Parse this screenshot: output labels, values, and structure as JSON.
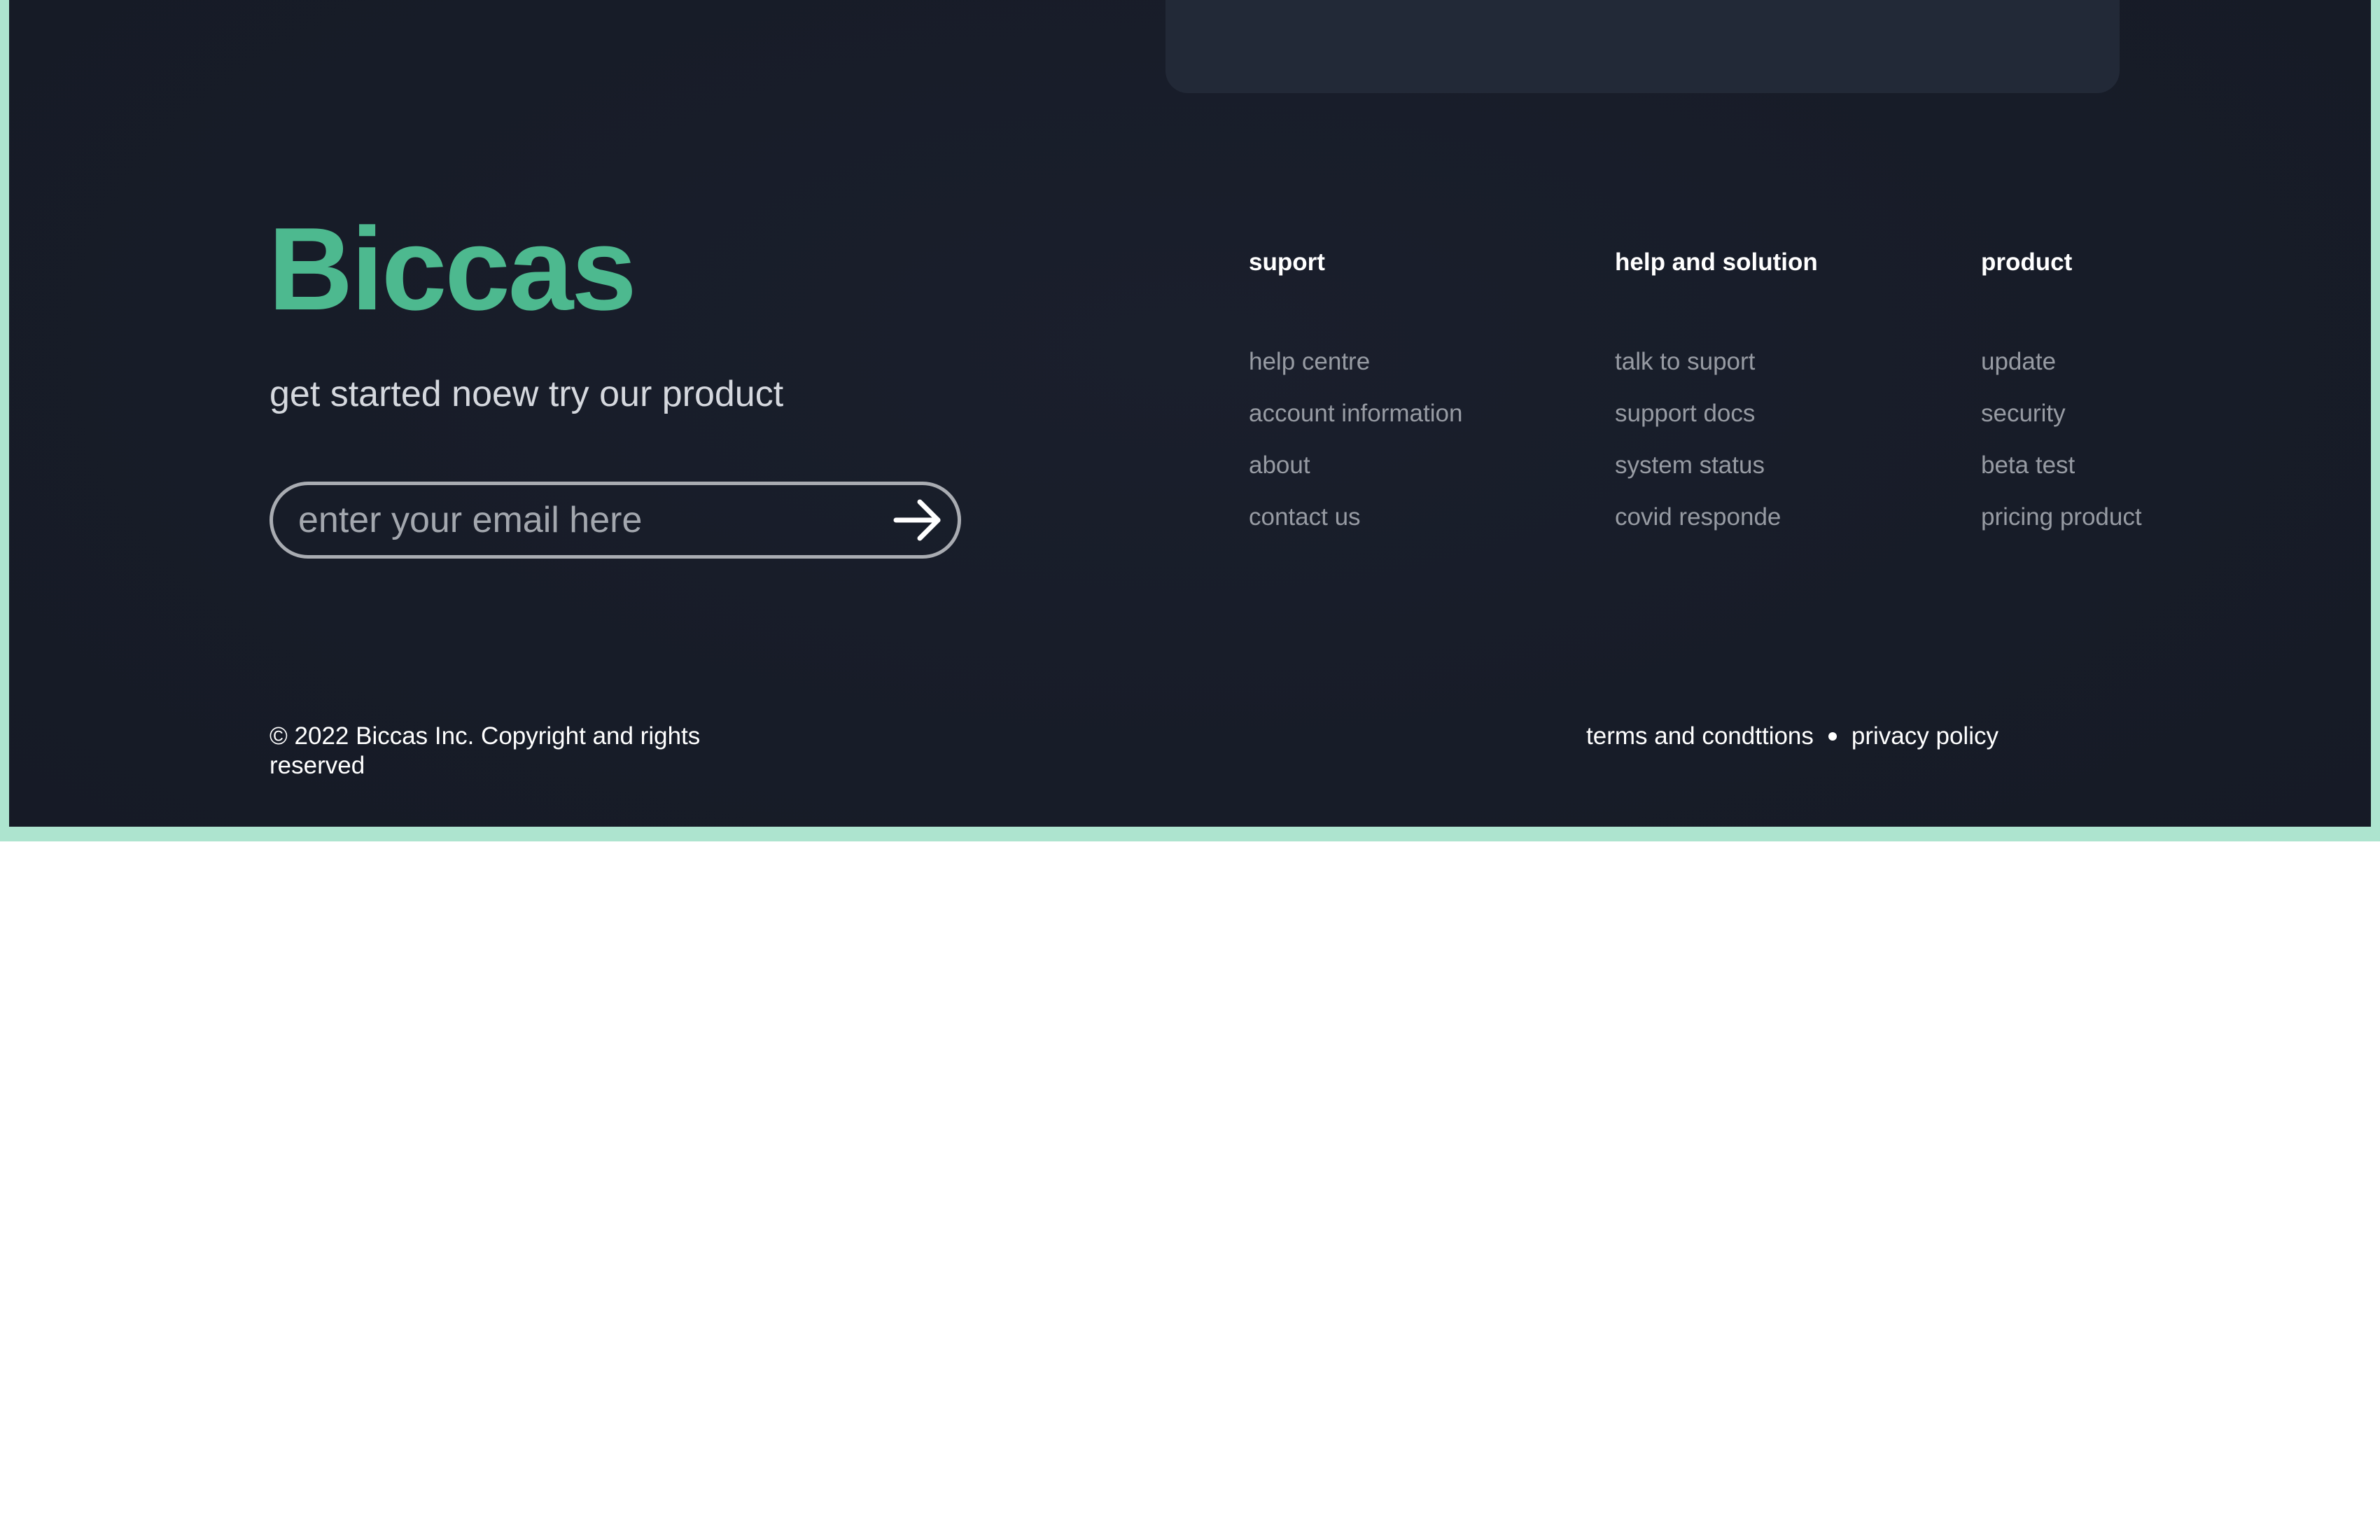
{
  "brand": {
    "name": "Biccas",
    "tagline": "get started noew try our product",
    "accent_color": "#4db98f"
  },
  "newsletter": {
    "email_placeholder": "enter your email here",
    "email_value": "",
    "submit_icon": "arrow-right-icon"
  },
  "columns": [
    {
      "heading": "suport",
      "links": [
        "help centre",
        "account information",
        "about",
        "contact us"
      ]
    },
    {
      "heading": "help and solution",
      "links": [
        "talk to suport",
        "support docs",
        "system status",
        "covid responde"
      ]
    },
    {
      "heading": "product",
      "links": [
        "update",
        "security",
        "beta test",
        "pricing product"
      ]
    }
  ],
  "bottom": {
    "copyright": "© 2022 Biccas Inc. Copyright and rights reserved",
    "terms": "terms and condttions",
    "privacy": "privacy policy"
  },
  "colors": {
    "background": "#171c28",
    "card": "#222937",
    "frame": "#ade4cf",
    "muted_text": "#979ba3"
  }
}
